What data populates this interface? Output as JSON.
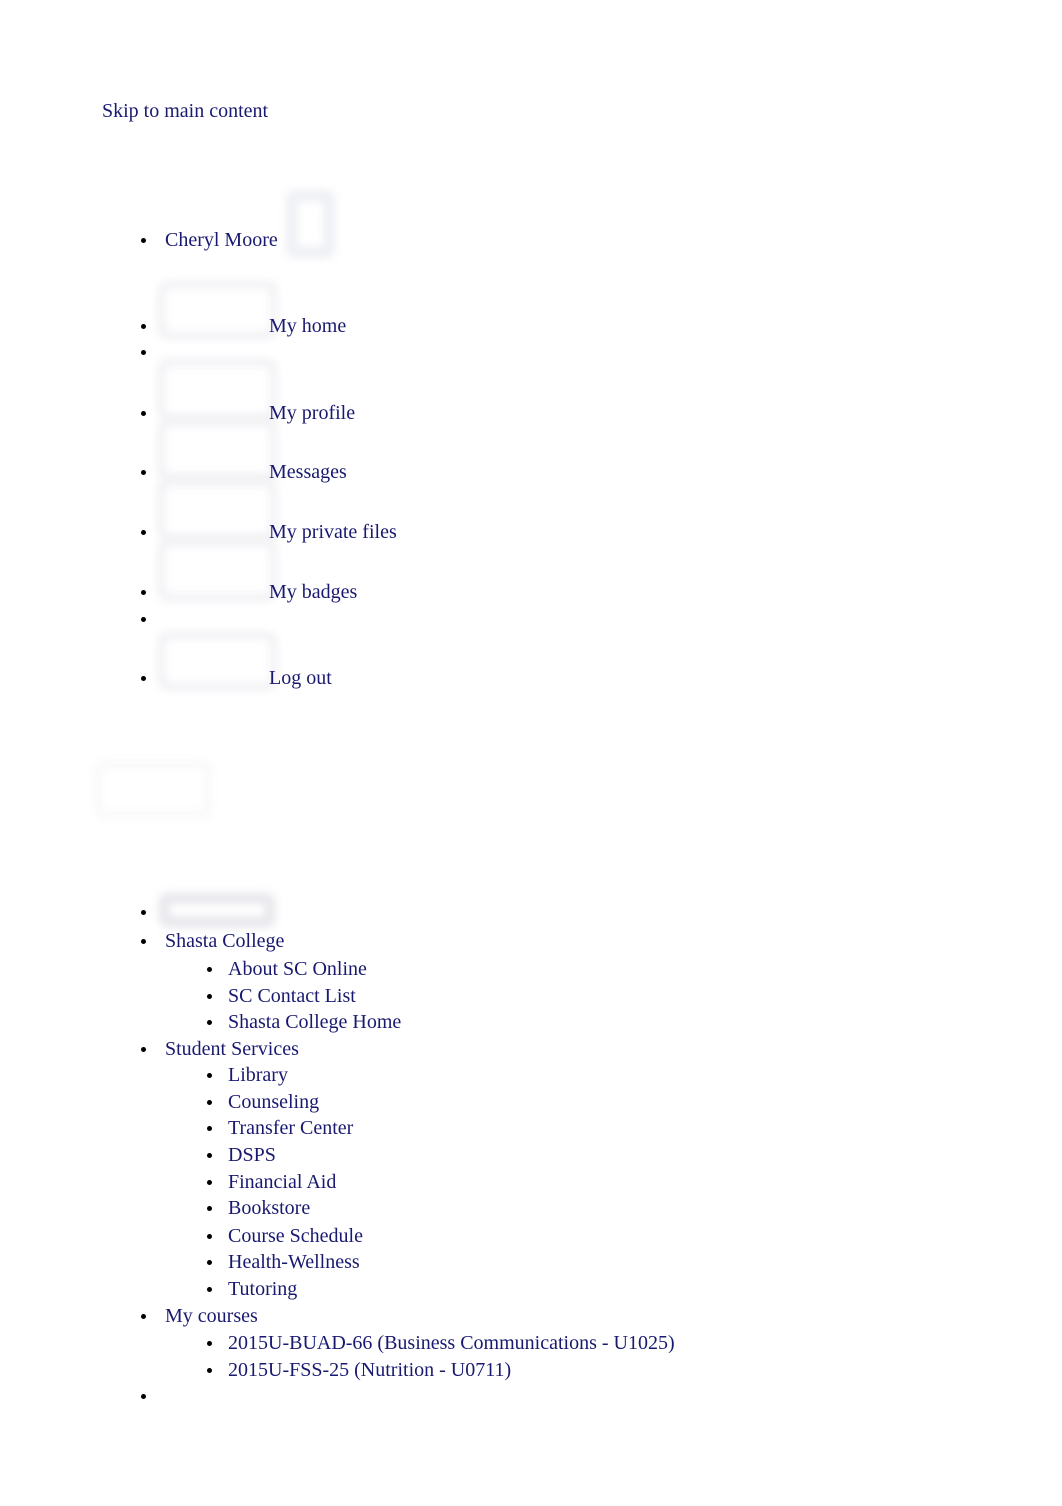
{
  "page": {
    "skip_link": "Skip to main content",
    "background_color": "#ffffff",
    "link_color": "#191970",
    "bullet_color": "#000000"
  },
  "user_menu": {
    "user_name": "Cheryl Moore",
    "avatar_icon": "user-avatar-placeholder",
    "items": [
      {
        "label": "My home",
        "icon": "home-icon"
      },
      {
        "label": "",
        "icon": "menu-divider"
      },
      {
        "label": "My profile",
        "icon": "profile-icon"
      },
      {
        "label": "Messages",
        "icon": "messages-icon"
      },
      {
        "label": "My private files",
        "icon": "private-files-icon"
      },
      {
        "label": "My badges",
        "icon": "badges-icon"
      },
      {
        "label": "",
        "icon": "menu-divider"
      },
      {
        "label": "Log out",
        "icon": "logout-icon"
      }
    ]
  },
  "logo": {
    "icon": "site-logo-placeholder"
  },
  "navigation": {
    "first_item_icon": "nav-toggle-placeholder",
    "sections": [
      {
        "label": "Shasta College",
        "children": [
          "About SC Online",
          "SC Contact List",
          "Shasta College Home"
        ]
      },
      {
        "label": "Student Services",
        "children": [
          "Library",
          "Counseling",
          "Transfer Center",
          "DSPS",
          "Financial Aid",
          "Bookstore",
          "Course Schedule",
          "Health-Wellness",
          "Tutoring"
        ]
      },
      {
        "label": "My courses",
        "children": [
          "2015U-BUAD-66 (Business Communications - U1025)",
          "2015U-FSS-25 (Nutrition - U0711)"
        ]
      }
    ],
    "trailing_empty_item": ""
  }
}
